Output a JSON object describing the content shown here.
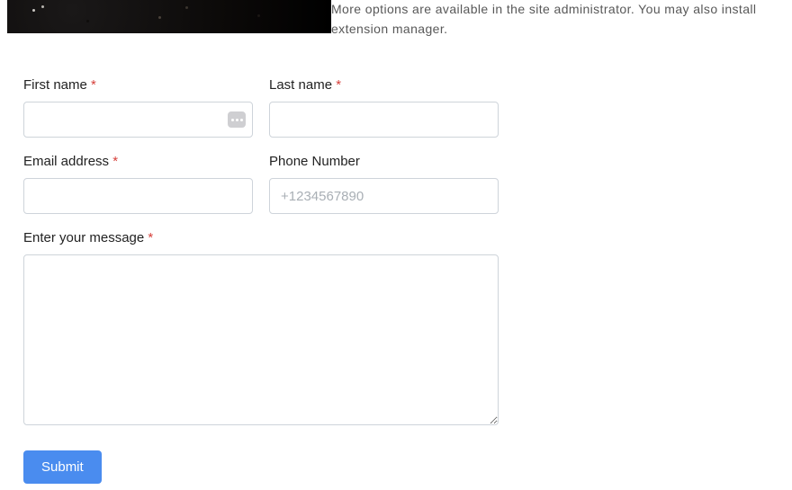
{
  "description": "More options are available in the site administrator. You may also install extension manager.",
  "form": {
    "first_name": {
      "label": "First name",
      "required": true,
      "value": ""
    },
    "last_name": {
      "label": "Last name",
      "required": true,
      "value": ""
    },
    "email": {
      "label": "Email address",
      "required": true,
      "value": ""
    },
    "phone": {
      "label": "Phone Number",
      "required": false,
      "placeholder": "+1234567890",
      "value": ""
    },
    "message": {
      "label": "Enter your message",
      "required": true,
      "value": ""
    },
    "submit_label": "Submit",
    "required_marker": "*"
  }
}
